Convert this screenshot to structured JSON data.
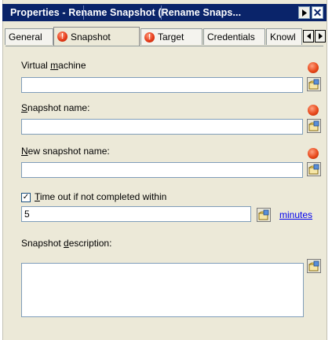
{
  "window": {
    "title": "Properties - Rename Snapshot (Rename Snaps..."
  },
  "tabs": [
    {
      "label": "General",
      "has_error": false
    },
    {
      "label": "Snapshot",
      "has_error": true,
      "active": true
    },
    {
      "label": "Target",
      "has_error": true
    },
    {
      "label": "Credentials",
      "has_error": false
    },
    {
      "label": "Knowl",
      "has_error": false
    }
  ],
  "form": {
    "vm_label": "Virtual machine",
    "vm_value": "",
    "snap_label": "Snapshot name:",
    "snap_value": "",
    "new_snap_label": "New snapshot name:",
    "new_snap_value": "",
    "timeout_label": "Time out if not completed within",
    "timeout_checked": true,
    "timeout_value": "5",
    "timeout_unit": "minutes",
    "desc_label": "Snapshot description:",
    "desc_value": ""
  },
  "icons": {
    "error": "error-exclamation-icon",
    "browse": "browse-variable-icon"
  },
  "colors": {
    "titlebar": "#0a246a",
    "error": "#e63b1a",
    "link": "#0000ee"
  }
}
